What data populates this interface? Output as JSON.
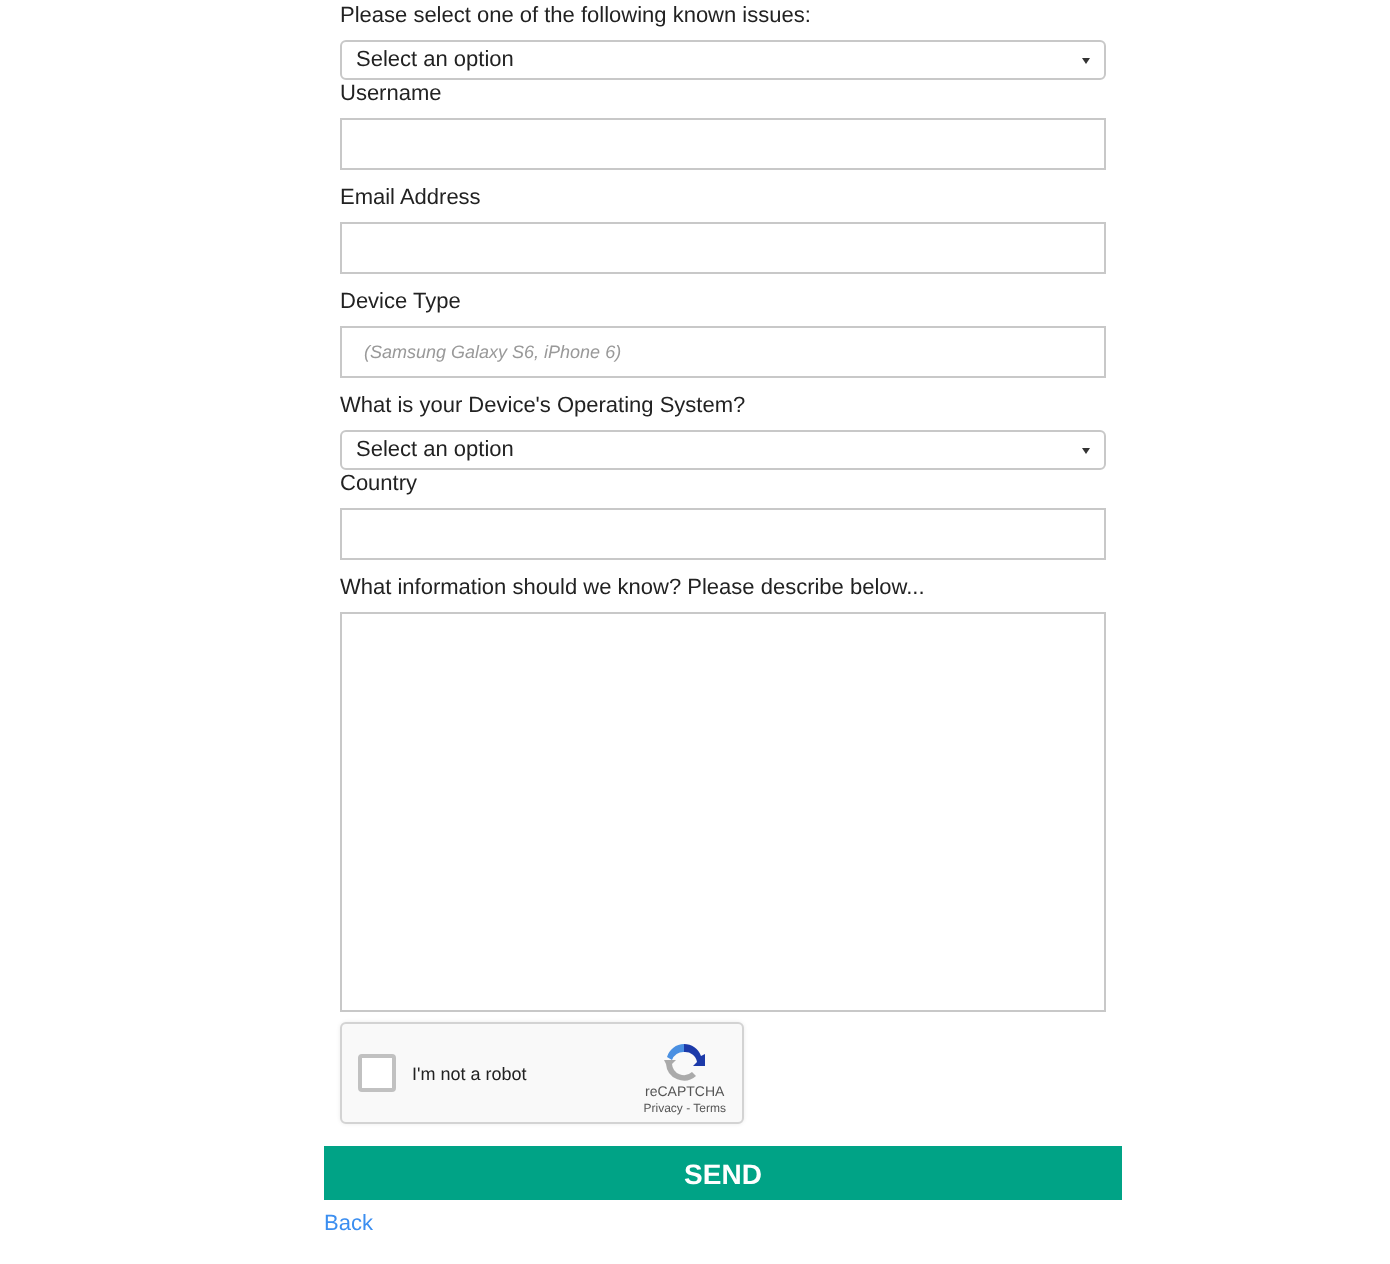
{
  "fields": [
    {
      "kind": "select",
      "label": "Please select one of the following known issues:",
      "value": "Select an option"
    },
    {
      "kind": "text",
      "label": "Username"
    },
    {
      "kind": "text",
      "label": "Email Address"
    },
    {
      "kind": "text",
      "label": "Device Type",
      "placeholder": "(Samsung Galaxy S6, iPhone 6)"
    },
    {
      "kind": "select",
      "label": "What is your Device's Operating System?",
      "value": "Select an option"
    },
    {
      "kind": "text",
      "label": "Country"
    },
    {
      "kind": "textarea",
      "label": "What information should we know? Please describe below..."
    }
  ],
  "captcha": {
    "label": "I'm not a robot",
    "checked": false,
    "brand": "reCAPTCHA",
    "links": "Privacy - Terms"
  },
  "submit": "SEND",
  "back_link": "Back"
}
